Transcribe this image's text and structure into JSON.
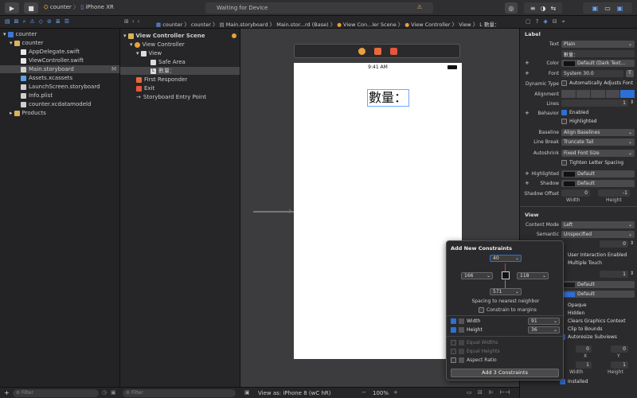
{
  "toolbar": {
    "scheme_app": "counter",
    "scheme_device": "iPhone XR",
    "status_text": "Waiting for Device"
  },
  "jumpbar": {
    "items": [
      "counter",
      "counter",
      "Main.storyboard",
      "Main.stor...rd (Base)",
      "View Con...ler Scene",
      "View Controller",
      "View",
      "數量："
    ]
  },
  "navigator": {
    "items": [
      {
        "label": "counter",
        "badge": ""
      },
      {
        "label": "counter",
        "badge": ""
      },
      {
        "label": "AppDelegate.swift",
        "badge": ""
      },
      {
        "label": "ViewController.swift",
        "badge": ""
      },
      {
        "label": "Main.storyboard",
        "badge": "M"
      },
      {
        "label": "Assets.xcassets",
        "badge": ""
      },
      {
        "label": "LaunchScreen.storyboard",
        "badge": ""
      },
      {
        "label": "Info.plist",
        "badge": ""
      },
      {
        "label": "counter.xcdatamodeld",
        "badge": ""
      },
      {
        "label": "Products",
        "badge": ""
      }
    ],
    "filter_placeholder": "Filter"
  },
  "outline": {
    "items": [
      {
        "label": "View Controller Scene"
      },
      {
        "label": "View Controller"
      },
      {
        "label": "View"
      },
      {
        "label": "Safe Area"
      },
      {
        "label": "數量："
      },
      {
        "label": "First Responder"
      },
      {
        "label": "Exit"
      },
      {
        "label": "Storyboard Entry Point"
      }
    ],
    "filter_placeholder": "Filter"
  },
  "canvas": {
    "status_time": "9:41 AM",
    "label_text": "數量：",
    "view_as": "View as: iPhone 8 (wC hR)",
    "zoom": "100%"
  },
  "inspector": {
    "label_section": "Label",
    "text_label": "Text",
    "text_value": "Plain",
    "text_content": "數量：",
    "color_label": "Color",
    "color_value": "Default (Dark Text...",
    "font_label": "Font",
    "font_value": "System 30.0",
    "dynamic_type_label": "Dynamic Type",
    "dynamic_type_value": "Automatically Adjusts Font",
    "alignment_label": "Alignment",
    "lines_label": "Lines",
    "lines_value": "1",
    "behavior_label": "Behavior",
    "enabled": "Enabled",
    "highlighted": "Highlighted",
    "baseline_label": "Baseline",
    "baseline_value": "Align Baselines",
    "line_break_label": "Line Break",
    "line_break_value": "Truncate Tail",
    "autoshrink_label": "Autoshrink",
    "autoshrink_value": "Fixed Font Size",
    "tighten": "Tighten Letter Spacing",
    "highlighted_label": "Highlighted",
    "highlighted_value": "Default",
    "shadow_label": "Shadow",
    "shadow_value": "Default",
    "shadow_offset_label": "Shadow Offset",
    "shadow_w": "0",
    "shadow_h": "-1",
    "width_label": "Width",
    "height_label": "Height",
    "view_section": "View",
    "content_mode_label": "Content Mode",
    "content_mode_value": "Left",
    "semantic_label": "Semantic",
    "semantic_value": "Unspecified",
    "tag_value": "0",
    "interaction_enabled": "User Interaction Enabled",
    "multiple_touch": "Multiple Touch",
    "alpha_value": "1",
    "bg_value": "Default",
    "tint_value": "Default",
    "opaque": "Opaque",
    "hidden": "Hidden",
    "clears_graphics": "Clears Graphics Context",
    "clip_bounds": "Clip to Bounds",
    "autoresize": "Autoresize Subviews",
    "stretch_x": "0",
    "stretch_y": "0",
    "stretch_w": "1",
    "stretch_h": "1",
    "x_label": "X",
    "y_label": "Y",
    "w_label": "Width",
    "h_label": "Height",
    "installed": "Installed"
  },
  "popup": {
    "title": "Add New Constraints",
    "top": "40",
    "left": "166",
    "right": "118",
    "bottom": "571",
    "spacing_label": "Spacing to nearest neighbor",
    "constrain_margins": "Constrain to margins",
    "width_label": "Width",
    "width_value": "91",
    "height_label": "Height",
    "height_value": "36",
    "equal_widths": "Equal Widths",
    "equal_heights": "Equal Heights",
    "aspect_ratio": "Aspect Ratio",
    "add_button": "Add 3 Constraints"
  }
}
